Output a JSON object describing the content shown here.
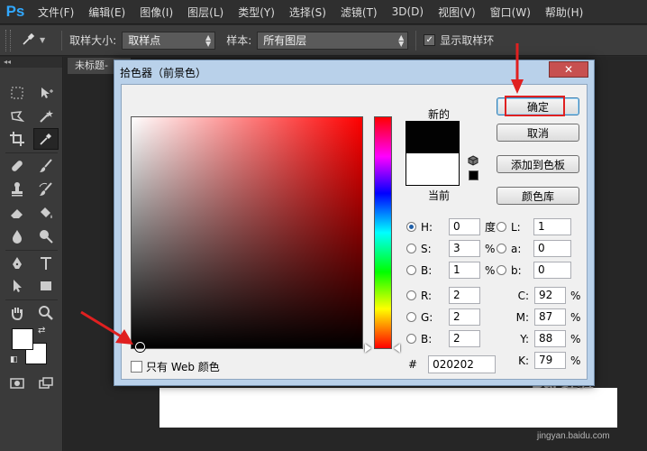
{
  "app": {
    "logo": "Ps"
  },
  "menu": [
    "文件(F)",
    "编辑(E)",
    "图像(I)",
    "图层(L)",
    "类型(Y)",
    "选择(S)",
    "滤镜(T)",
    "3D(D)",
    "视图(V)",
    "窗口(W)",
    "帮助(H)"
  ],
  "options": {
    "sample_size_label": "取样大小:",
    "sample_size_value": "取样点",
    "sample_label": "样本:",
    "sample_value": "所有图层",
    "show_ring_label": "显示取样环",
    "show_ring_checked": true
  },
  "document": {
    "tab_label": "未标题-"
  },
  "dialog": {
    "title": "拾色器（前景色）",
    "new_label": "新的",
    "current_label": "当前",
    "new_color": "#020202",
    "current_color": "#ffffff",
    "buttons": {
      "ok": "确定",
      "cancel": "取消",
      "add_swatch": "添加到色板",
      "color_library": "颜色库"
    },
    "web_only_label": "只有 Web 颜色",
    "hsb": [
      {
        "label": "H:",
        "value": "0",
        "unit": "度",
        "selected": true
      },
      {
        "label": "S:",
        "value": "3",
        "unit": "%",
        "selected": false
      },
      {
        "label": "B:",
        "value": "1",
        "unit": "%",
        "selected": false
      }
    ],
    "rgb": [
      {
        "label": "R:",
        "value": "2"
      },
      {
        "label": "G:",
        "value": "2"
      },
      {
        "label": "B:",
        "value": "2"
      }
    ],
    "lab": [
      {
        "label": "L:",
        "value": "1"
      },
      {
        "label": "a:",
        "value": "0"
      },
      {
        "label": "b:",
        "value": "0"
      }
    ],
    "cmyk": [
      {
        "label": "C:",
        "value": "92",
        "unit": "%"
      },
      {
        "label": "M:",
        "value": "87",
        "unit": "%"
      },
      {
        "label": "Y:",
        "value": "88",
        "unit": "%"
      },
      {
        "label": "K:",
        "value": "79",
        "unit": "%"
      }
    ],
    "hex_symbol": "#",
    "hex": "020202",
    "close_symbol": "✕"
  },
  "watermark": {
    "main": "Bai 经验",
    "sub": "jingyan.baidu.com"
  },
  "colors": {
    "accent_ps": "#31a8ff",
    "annotation": "#e02020"
  }
}
